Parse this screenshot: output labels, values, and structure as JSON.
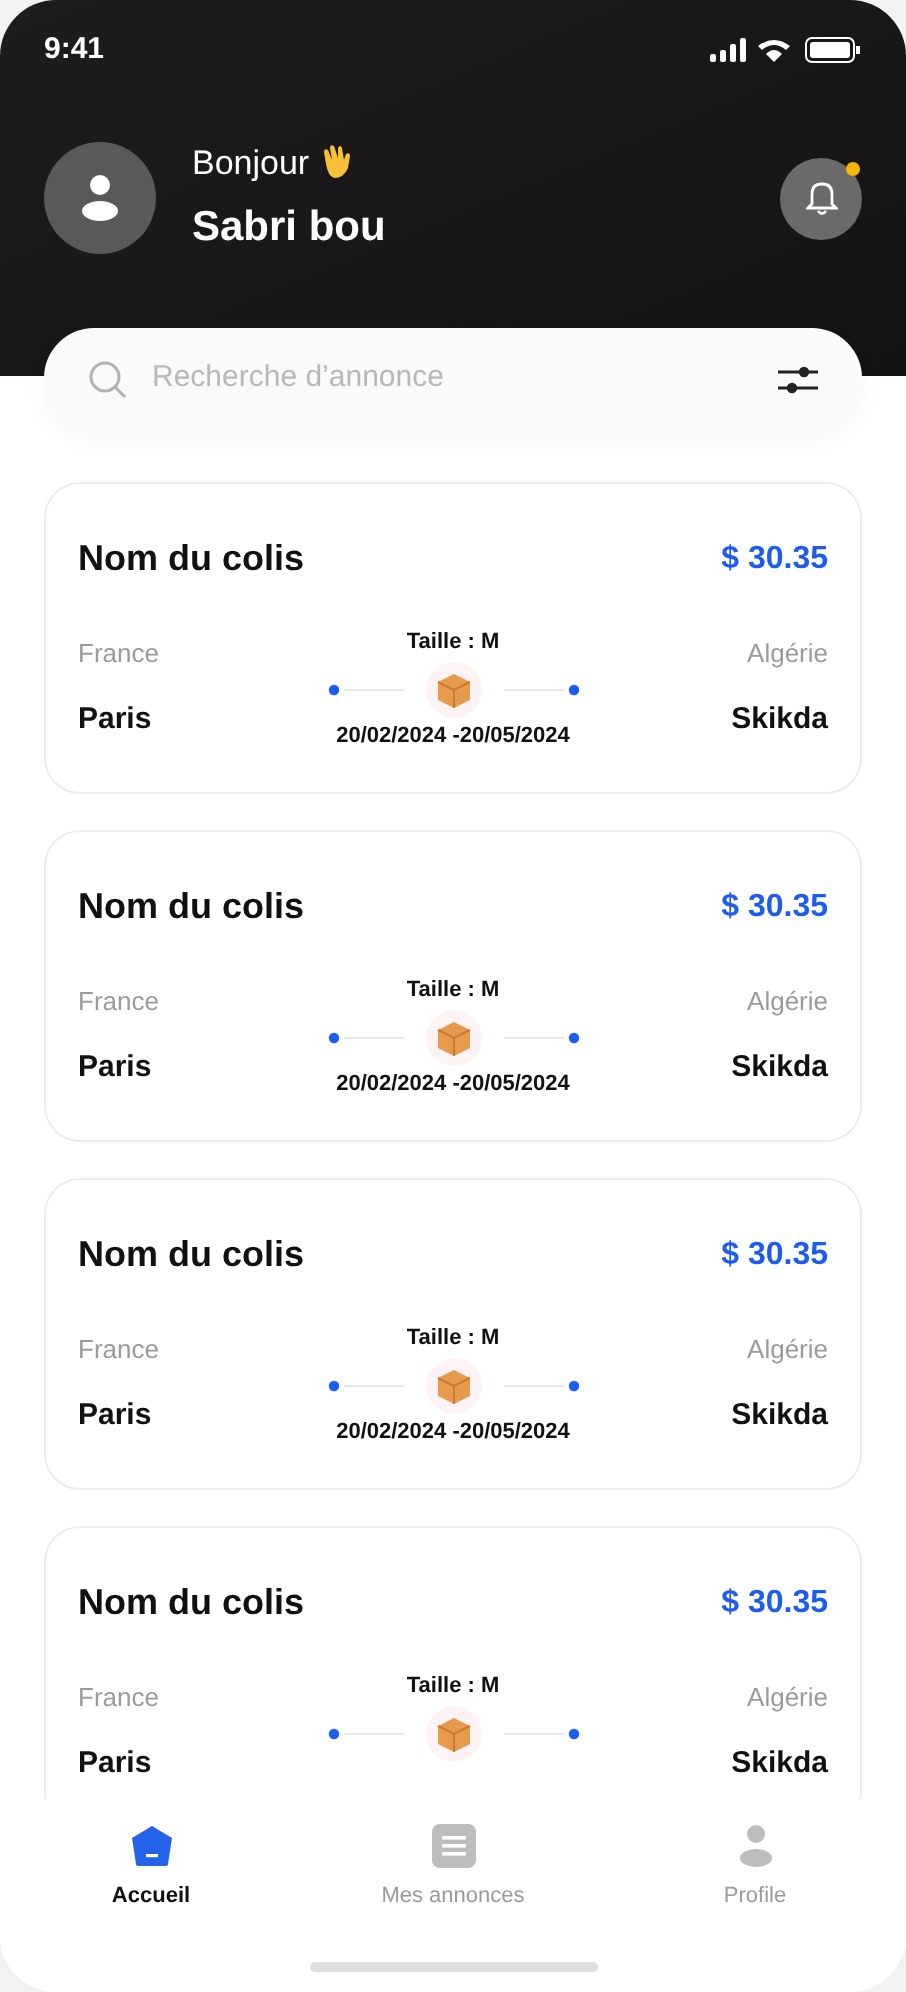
{
  "status_bar": {
    "time": "9:41"
  },
  "header": {
    "greeting": "Bonjour",
    "user_name": "Sabri bou",
    "notification_unread": true
  },
  "search": {
    "placeholder": "Recherche d’annonce"
  },
  "parcels": [
    {
      "name": "Nom du colis",
      "price": "$ 30.35",
      "size": "Taille : M",
      "from_country": "France",
      "from_city": "Paris",
      "to_country": "Algérie",
      "to_city": "Skikda",
      "dates": "20/02/2024 -20/05/2024"
    },
    {
      "name": "Nom du colis",
      "price": "$ 30.35",
      "size": "Taille : M",
      "from_country": "France",
      "from_city": "Paris",
      "to_country": "Algérie",
      "to_city": "Skikda",
      "dates": "20/02/2024 -20/05/2024"
    },
    {
      "name": "Nom du colis",
      "price": "$ 30.35",
      "size": "Taille : M",
      "from_country": "France",
      "from_city": "Paris",
      "to_country": "Algérie",
      "to_city": "Skikda",
      "dates": "20/02/2024 -20/05/2024"
    },
    {
      "name": "Nom du colis",
      "price": "$ 30.35",
      "size": "Taille : M",
      "from_country": "France",
      "from_city": "Paris",
      "to_country": "Algérie",
      "to_city": "Skikda"
    }
  ],
  "bottom_nav": [
    {
      "kind": "home",
      "label": "Accueil",
      "selected": true
    },
    {
      "kind": "list",
      "label": "Mes annonces",
      "selected": false
    },
    {
      "kind": "profile",
      "label": "Profile",
      "selected": false
    }
  ]
}
